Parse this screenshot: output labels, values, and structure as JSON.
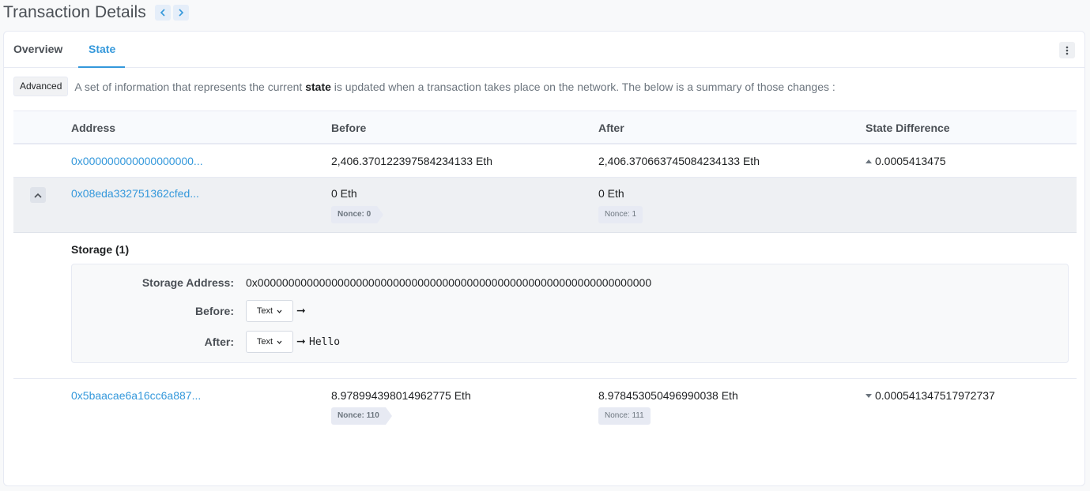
{
  "header": {
    "title": "Transaction Details",
    "prev_icon": "chevron-left-icon",
    "next_icon": "chevron-right-icon"
  },
  "tabs": [
    {
      "label": "Overview"
    },
    {
      "label": "State",
      "active": true
    }
  ],
  "more_icon": "vertical-dots-icon",
  "info": {
    "badge": "Advanced",
    "text_before": "A set of information that represents the current ",
    "text_bold": "state",
    "text_after": " is updated when a transaction takes place on the network. The below is a summary of those changes :"
  },
  "table": {
    "headers": {
      "address": "Address",
      "before": "Before",
      "after": "After",
      "diff": "State Difference"
    },
    "rows": [
      {
        "address": "0x000000000000000000...",
        "before": "2,406.370122397584234133 Eth",
        "after": "2,406.370663745084234133 Eth",
        "diff": "0.0005413475",
        "diff_direction": "up"
      },
      {
        "address": "0x08eda332751362cfed...",
        "before": "0 Eth",
        "after": "0 Eth",
        "before_nonce": "Nonce: 0",
        "after_nonce": "Nonce: 1",
        "expanded": true
      },
      {
        "address": "0x5baacae6a16cc6a887...",
        "before": "8.978994398014962775 Eth",
        "after": "8.978453050496990038 Eth",
        "before_nonce": "Nonce: 110",
        "after_nonce": "Nonce: 111",
        "diff": "0.000541347517972737",
        "diff_direction": "down"
      }
    ]
  },
  "storage": {
    "title": "Storage (1)",
    "address_label": "Storage Address:",
    "address_value": "0x0000000000000000000000000000000000000000000000000000000000000000",
    "before_label": "Before:",
    "before_format": "Text",
    "before_value": "",
    "after_label": "After:",
    "after_format": "Text",
    "after_value": "Hello",
    "arrow": "➞"
  },
  "colors": {
    "accent": "#3498db",
    "header_bg": "#f8fafd",
    "expanded_row_bg": "#eef0f3"
  }
}
